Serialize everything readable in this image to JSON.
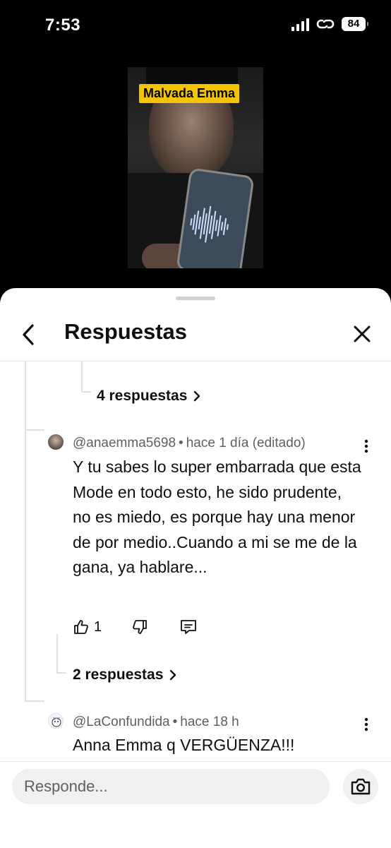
{
  "status_bar": {
    "time": "7:53",
    "battery": "84"
  },
  "video": {
    "overlay_label": "Malvada Emma"
  },
  "header": {
    "title": "Respuestas"
  },
  "thread": {
    "parent_more_replies": "4 respuestas",
    "comments": [
      {
        "author": "@anaemma5698",
        "time": "hace 1 día (editado)",
        "text": "Y tu sabes lo super embarrada que esta Mode en todo esto, he sido prudente, no es miedo, es porque hay una menor de por medio..Cuando a mi se me de la gana, ya hablare...",
        "likes": "1",
        "more_replies": "2 respuestas"
      },
      {
        "author": "@LaConfundida",
        "time": "hace 18 h",
        "text": "Anna Emma q VERGÜENZA!!!"
      }
    ]
  },
  "composer": {
    "placeholder": "Responde..."
  },
  "icons": {
    "back": "chevron-left-icon",
    "close": "close-icon",
    "like": "thumbs-up-icon",
    "dislike": "thumbs-down-icon",
    "reply": "comment-icon",
    "more": "more-vertical-icon",
    "camera": "camera-icon"
  }
}
